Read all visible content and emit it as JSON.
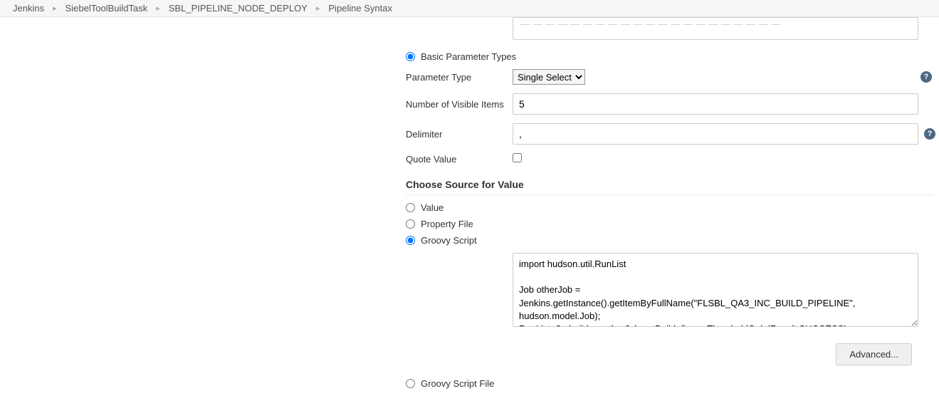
{
  "breadcrumb": {
    "items": [
      "Jenkins",
      "SiebelToolBuildTask",
      "SBL_PIPELINE_NODE_DEPLOY",
      "Pipeline Syntax"
    ]
  },
  "truncated_field": {
    "partial_text": "— — — — —  — — — —  — — — — — —  — — — — — —"
  },
  "basic_param": {
    "radio_label": "Basic Parameter Types",
    "param_type": {
      "label": "Parameter Type",
      "selected": "Single Select"
    },
    "visible_items": {
      "label": "Number of Visible Items",
      "value": "5"
    },
    "delimiter": {
      "label": "Delimiter",
      "value": ","
    },
    "quote_value": {
      "label": "Quote Value",
      "checked": false
    }
  },
  "source": {
    "heading": "Choose Source for Value",
    "options": {
      "value": "Value",
      "property_file": "Property File",
      "groovy_script": "Groovy Script",
      "groovy_script_file": "Groovy Script File"
    },
    "selected": "groovy_script",
    "script_content": "import hudson.util.RunList\n\nJob otherJob = Jenkins.getInstance().getItemByFullName(\"FLSBL_QA3_INC_BUILD_PIPELINE\", hudson.model.Job);\nRunList<?> builds = otherJob.getBuilds().overThresholdOnly(Result.SUCCESS)"
  },
  "advanced_label": "Advanced...",
  "help_glyph": "?"
}
